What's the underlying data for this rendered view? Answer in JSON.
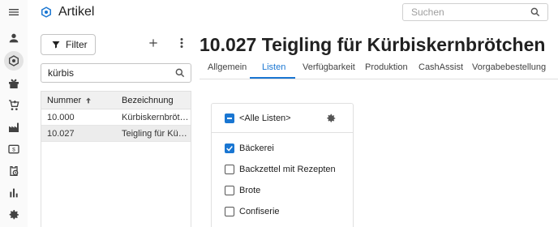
{
  "app": {
    "title": "Artikel",
    "search_placeholder": "Suchen",
    "accent_color": "#1976d2"
  },
  "rail": {
    "icons": [
      "menu-icon",
      "person-icon",
      "article-icon",
      "gift-icon",
      "cart-icon",
      "factory-icon",
      "cash-icon",
      "clipboard-clock-icon",
      "bar-chart-icon",
      "settings-icon"
    ],
    "active": "article-icon"
  },
  "sidebar": {
    "filter_label": "Filter",
    "search_value": "kürbis",
    "columns": {
      "number": "Nummer",
      "description": "Bezeichnung"
    },
    "sort": {
      "column": "number",
      "direction": "ascending"
    },
    "rows": [
      {
        "number": "10.000",
        "description": "Kürbiskernbrötchen"
      },
      {
        "number": "10.027",
        "description": "Teigling für Kürbiskernbrötchen",
        "selected": true
      }
    ]
  },
  "detail": {
    "title": "10.027 Teigling für Kürbiskernbrötchen",
    "tabs": [
      "Allgemein",
      "Listen",
      "Verfügbarkeit",
      "Produktion",
      "CashAssist",
      "Vorgabebestellung"
    ],
    "active_tab": "Listen"
  },
  "lists": {
    "all_label": "<Alle Listen>",
    "all_state": "indeterminate",
    "items": [
      {
        "label": "Bäckerei",
        "checked": true
      },
      {
        "label": "Backzettel mit Rezepten",
        "checked": false
      },
      {
        "label": "Brote",
        "checked": false
      },
      {
        "label": "Confiserie",
        "checked": false
      }
    ]
  }
}
